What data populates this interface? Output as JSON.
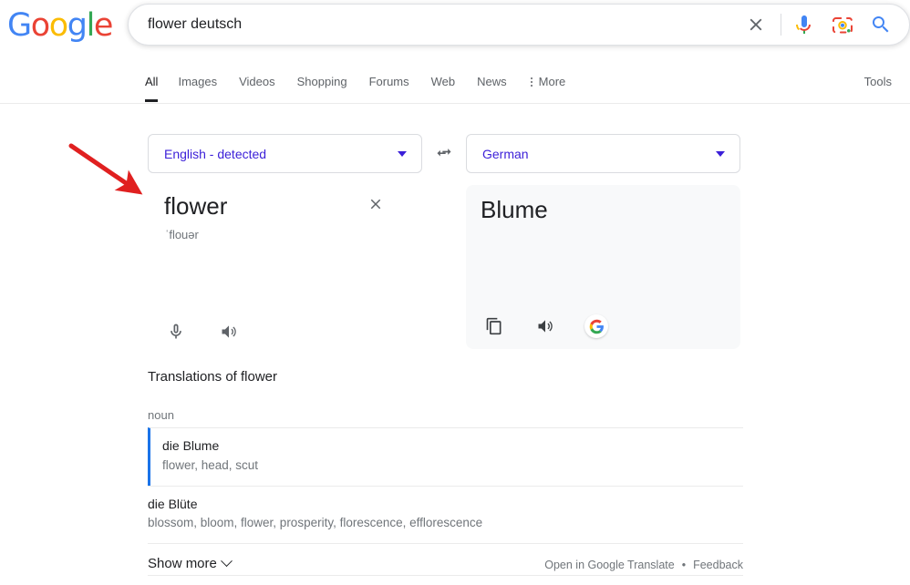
{
  "brand": {
    "name": "Google",
    "letters": [
      {
        "ch": "G",
        "color": "#4285F4"
      },
      {
        "ch": "o",
        "color": "#EA4335"
      },
      {
        "ch": "o",
        "color": "#FBBC05"
      },
      {
        "ch": "g",
        "color": "#4285F4"
      },
      {
        "ch": "l",
        "color": "#34A853"
      },
      {
        "ch": "e",
        "color": "#EA4335"
      }
    ]
  },
  "search": {
    "query": "flower deutsch",
    "placeholder": "Search",
    "clear_icon": "close-icon",
    "voice_icon": "microphone-icon",
    "lens_icon": "google-lens-icon",
    "submit_icon": "search-icon"
  },
  "nav": {
    "tabs": [
      {
        "label": "All",
        "active": true
      },
      {
        "label": "Images",
        "active": false
      },
      {
        "label": "Videos",
        "active": false
      },
      {
        "label": "Shopping",
        "active": false
      },
      {
        "label": "Forums",
        "active": false
      },
      {
        "label": "Web",
        "active": false
      },
      {
        "label": "News",
        "active": false
      }
    ],
    "more_label": "More",
    "more_icon": "kebab-menu-icon",
    "tools_label": "Tools"
  },
  "translate": {
    "source_language": "English - detected",
    "target_language": "German",
    "swap_icon": "swap-arrows-icon",
    "source_text": "flower",
    "source_phonetic": "ˈflouər",
    "clear_icon": "close-icon",
    "source_mic_icon": "microphone-icon",
    "source_speaker_icon": "speaker-icon",
    "target_text": "Blume",
    "target_copy_icon": "copy-icon",
    "target_speaker_icon": "speaker-icon",
    "target_google_icon": "google-g-icon",
    "accent_color": "#1a73e8",
    "link_color": "#3b1fd8",
    "panel_bg": "#f8f9fa"
  },
  "translations": {
    "title": "Translations of flower",
    "part_of_speech": "noun",
    "rows": [
      {
        "word": "die Blume",
        "synonyms": "flower, head, scut",
        "highlighted": true
      },
      {
        "word": "die Blüte",
        "synonyms": "blossom, bloom, flower, prosperity, florescence, efflorescence",
        "highlighted": false
      }
    ],
    "show_more_label": "Show more",
    "show_more_icon": "chevron-down-icon"
  },
  "footer": {
    "open_in_translate": "Open in Google Translate",
    "separator": "•",
    "feedback": "Feedback"
  },
  "annotation": {
    "type": "arrow",
    "color": "#e02020",
    "points_to": "source-text-flower"
  }
}
